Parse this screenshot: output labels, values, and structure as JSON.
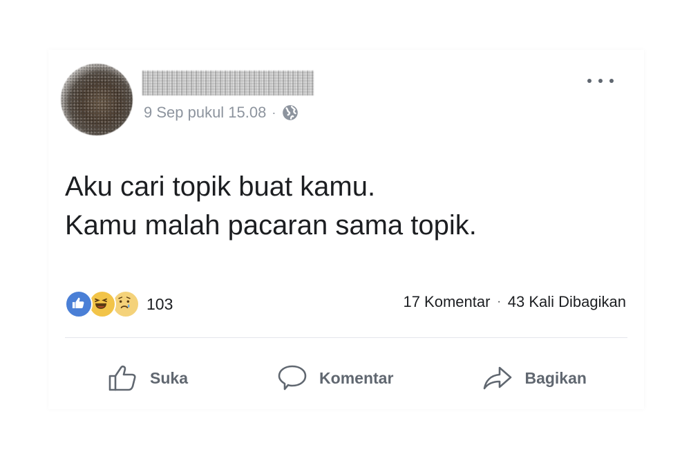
{
  "post": {
    "timestamp": "9 Sep pukul 15.08",
    "separator": "·",
    "privacy_icon": "globe-icon",
    "more_icon": "more-options-icon",
    "text_lines": [
      "Aku cari topik buat kamu.",
      "Kamu malah pacaran sama topik."
    ]
  },
  "reactions": {
    "icons": [
      "like-icon",
      "haha-icon",
      "sad-icon"
    ],
    "count": "103",
    "colors": {
      "like": "#4a7fd6",
      "haha": "#f2c449",
      "sad": "#f4d27a"
    }
  },
  "stats": {
    "comments": "17 Komentar",
    "separator": "·",
    "shares": "43 Kali Dibagikan"
  },
  "actions": {
    "like_label": "Suka",
    "comment_label": "Komentar",
    "share_label": "Bagikan"
  }
}
